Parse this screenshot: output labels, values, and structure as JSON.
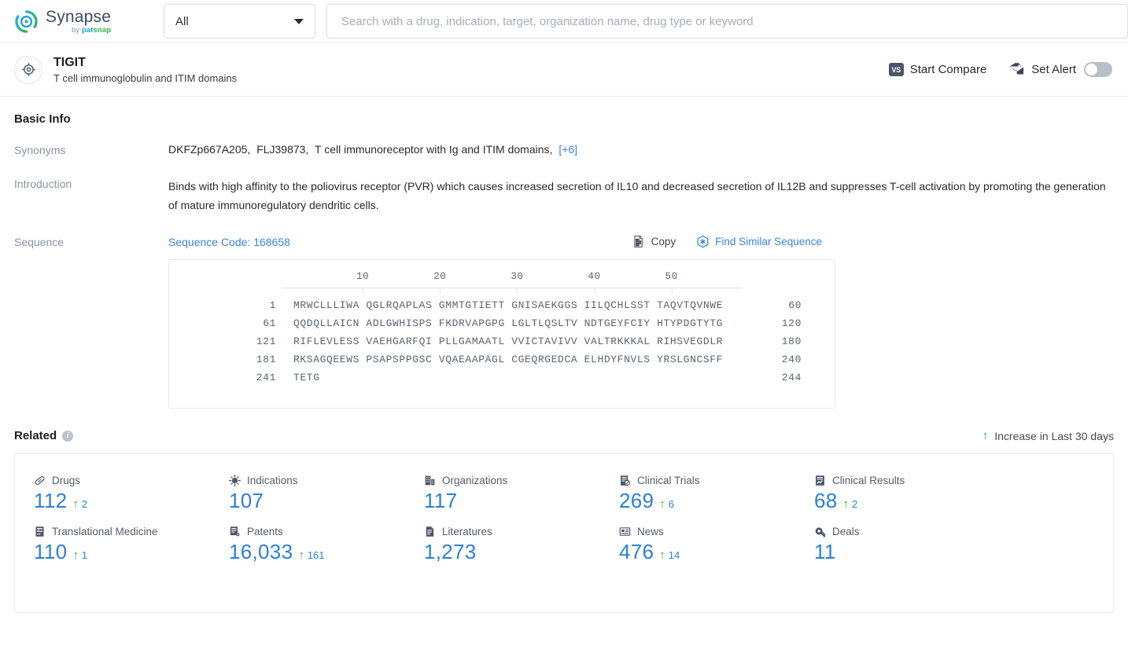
{
  "topbar": {
    "logo": {
      "name": "Synapse",
      "by": "by ",
      "pat": "pat",
      "snap": "snap",
      "icon": "synapse-logo-icon"
    },
    "scope": {
      "value": "All",
      "icon": "chevron-down-icon"
    },
    "search": {
      "value": "",
      "placeholder": "Search with a drug, indication, target, organization name, drug type or keyword"
    }
  },
  "entity": {
    "icon": "target-crosshair-icon",
    "name": "TIGIT",
    "description": "T cell immunoglobulin and ITIM domains",
    "actions": {
      "compare_label": "Start Compare",
      "compare_icon_text": "VS",
      "alert_label": "Set Alert",
      "alert_icon": "mail-alert-icon",
      "alert_toggle_on": false
    }
  },
  "basic_info": {
    "title": "Basic Info",
    "synonyms": {
      "label": "Synonyms",
      "items": [
        "DKFZp667A205,",
        "FLJ39873,",
        "T cell immunoreceptor with Ig and ITIM domains,"
      ],
      "more": "[+6]"
    },
    "introduction": {
      "label": "Introduction",
      "text": "Binds with high affinity to the poliovirus receptor (PVR) which causes increased secretion of IL10 and decreased secretion of IL12B and suppresses T-cell activation by promoting the generation of mature immunoregulatory dendritic cells."
    },
    "sequence": {
      "label": "Sequence",
      "code_label": "Sequence Code: 168658",
      "copy_label": "Copy",
      "copy_icon": "copy-icon",
      "find_label": "Find Similar Sequence",
      "find_icon": "find-similar-sequence-icon",
      "ruler": [
        "10",
        "20",
        "30",
        "40",
        "50"
      ],
      "lines": [
        {
          "start": "1",
          "chunks": "MRWCLLLIWA QGLRQAPLAS GMMTGTIETT GNISAEKGGS IILQCHLSST TAQVTQVNWE",
          "end": "60"
        },
        {
          "start": "61",
          "chunks": "QQDQLLAICN ADLGWHISPS FKDRVAPGPG LGLTLQSLTV NDTGEYFCIY HTYPDGTYTG",
          "end": "120"
        },
        {
          "start": "121",
          "chunks": "RIFLEVLESS VAEHGARFQI PLLGAMAATL VVICTAVIVV VALTRKKKAL RIHSVEGDLR",
          "end": "180"
        },
        {
          "start": "181",
          "chunks": "RKSAGQEEWS PSAPSPPGSC VQAEAAPAGL CGEQRGEDCA ELHDYFNVLS YRSLGNCSFF",
          "end": "240"
        },
        {
          "start": "241",
          "chunks": "TETG",
          "end": "244"
        }
      ]
    }
  },
  "related": {
    "title": "Related",
    "info_icon": "info-icon",
    "legend": {
      "arrow": "↑",
      "label": "Increase in Last 30 days"
    },
    "rows": [
      [
        {
          "icon": "pill-icon",
          "label": "Drugs",
          "value": "112",
          "delta": "2"
        },
        {
          "icon": "virus-icon",
          "label": "Indications",
          "value": "107",
          "delta": ""
        },
        {
          "icon": "building-icon",
          "label": "Organizations",
          "value": "117",
          "delta": ""
        },
        {
          "icon": "clinical-trial-icon",
          "label": "Clinical Trials",
          "value": "269",
          "delta": "6"
        },
        {
          "icon": "clinical-result-icon",
          "label": "Clinical Results",
          "value": "68",
          "delta": "2"
        }
      ],
      [
        {
          "icon": "translational-icon",
          "label": "Translational Medicine",
          "value": "110",
          "delta": "1"
        },
        {
          "icon": "patent-icon",
          "label": "Patents",
          "value": "16,033",
          "delta": "161"
        },
        {
          "icon": "literature-icon",
          "label": "Literatures",
          "value": "1,273",
          "delta": ""
        },
        {
          "icon": "news-icon",
          "label": "News",
          "value": "476",
          "delta": "14"
        },
        {
          "icon": "deal-icon",
          "label": "Deals",
          "value": "11",
          "delta": ""
        }
      ]
    ]
  },
  "colors": {
    "link": "#3b82e0",
    "stat": "#2b7fd6",
    "increase": "#2cab3f",
    "label": "#8a93a0"
  }
}
